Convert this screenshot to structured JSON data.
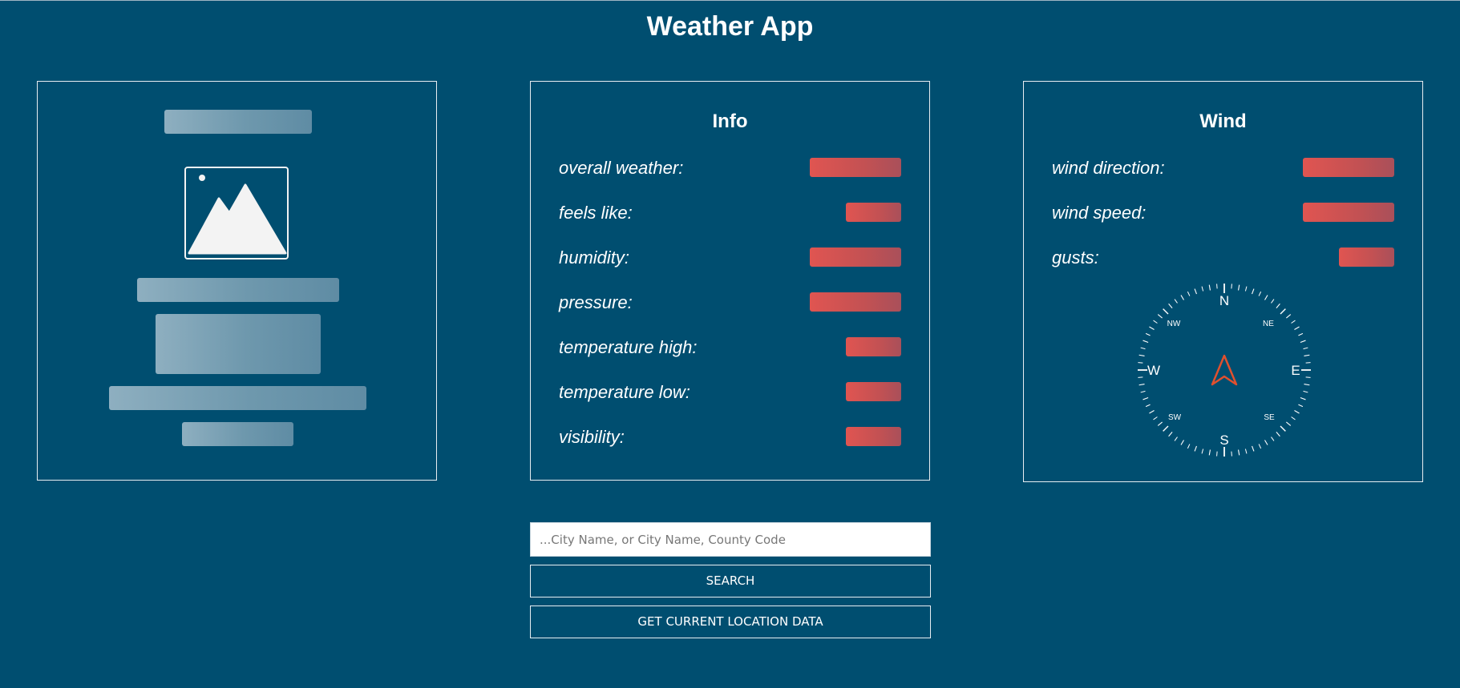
{
  "app": {
    "title": "Weather App"
  },
  "colors": {
    "background": "#004e70",
    "card_border": "#e8eef2",
    "value_placeholder": "#e05551",
    "skeleton": "#7fa4b8",
    "compass_arrow": "#e0502e"
  },
  "info": {
    "title": "Info",
    "rows": [
      {
        "label": "overall weather:",
        "value": ""
      },
      {
        "label": "feels like:",
        "value": ""
      },
      {
        "label": "humidity:",
        "value": ""
      },
      {
        "label": "pressure:",
        "value": ""
      },
      {
        "label": "temperature high:",
        "value": ""
      },
      {
        "label": "temperature low:",
        "value": ""
      },
      {
        "label": "visibility:",
        "value": ""
      }
    ]
  },
  "wind": {
    "title": "Wind",
    "rows": [
      {
        "label": "wind direction:",
        "value": ""
      },
      {
        "label": "wind speed:",
        "value": ""
      },
      {
        "label": "gusts:",
        "value": ""
      }
    ],
    "compass": {
      "n": "N",
      "s": "S",
      "e": "E",
      "w": "W",
      "ne": "NE",
      "nw": "NW",
      "se": "SE",
      "sw": "SW",
      "icon": "compass-arrow-icon"
    }
  },
  "left_panel": {
    "image_icon": "image-placeholder-icon"
  },
  "search": {
    "placeholder": "...City Name, or City Name, County Code",
    "value": "",
    "search_label": "SEARCH",
    "location_label": "GET CURRENT LOCATION DATA"
  }
}
